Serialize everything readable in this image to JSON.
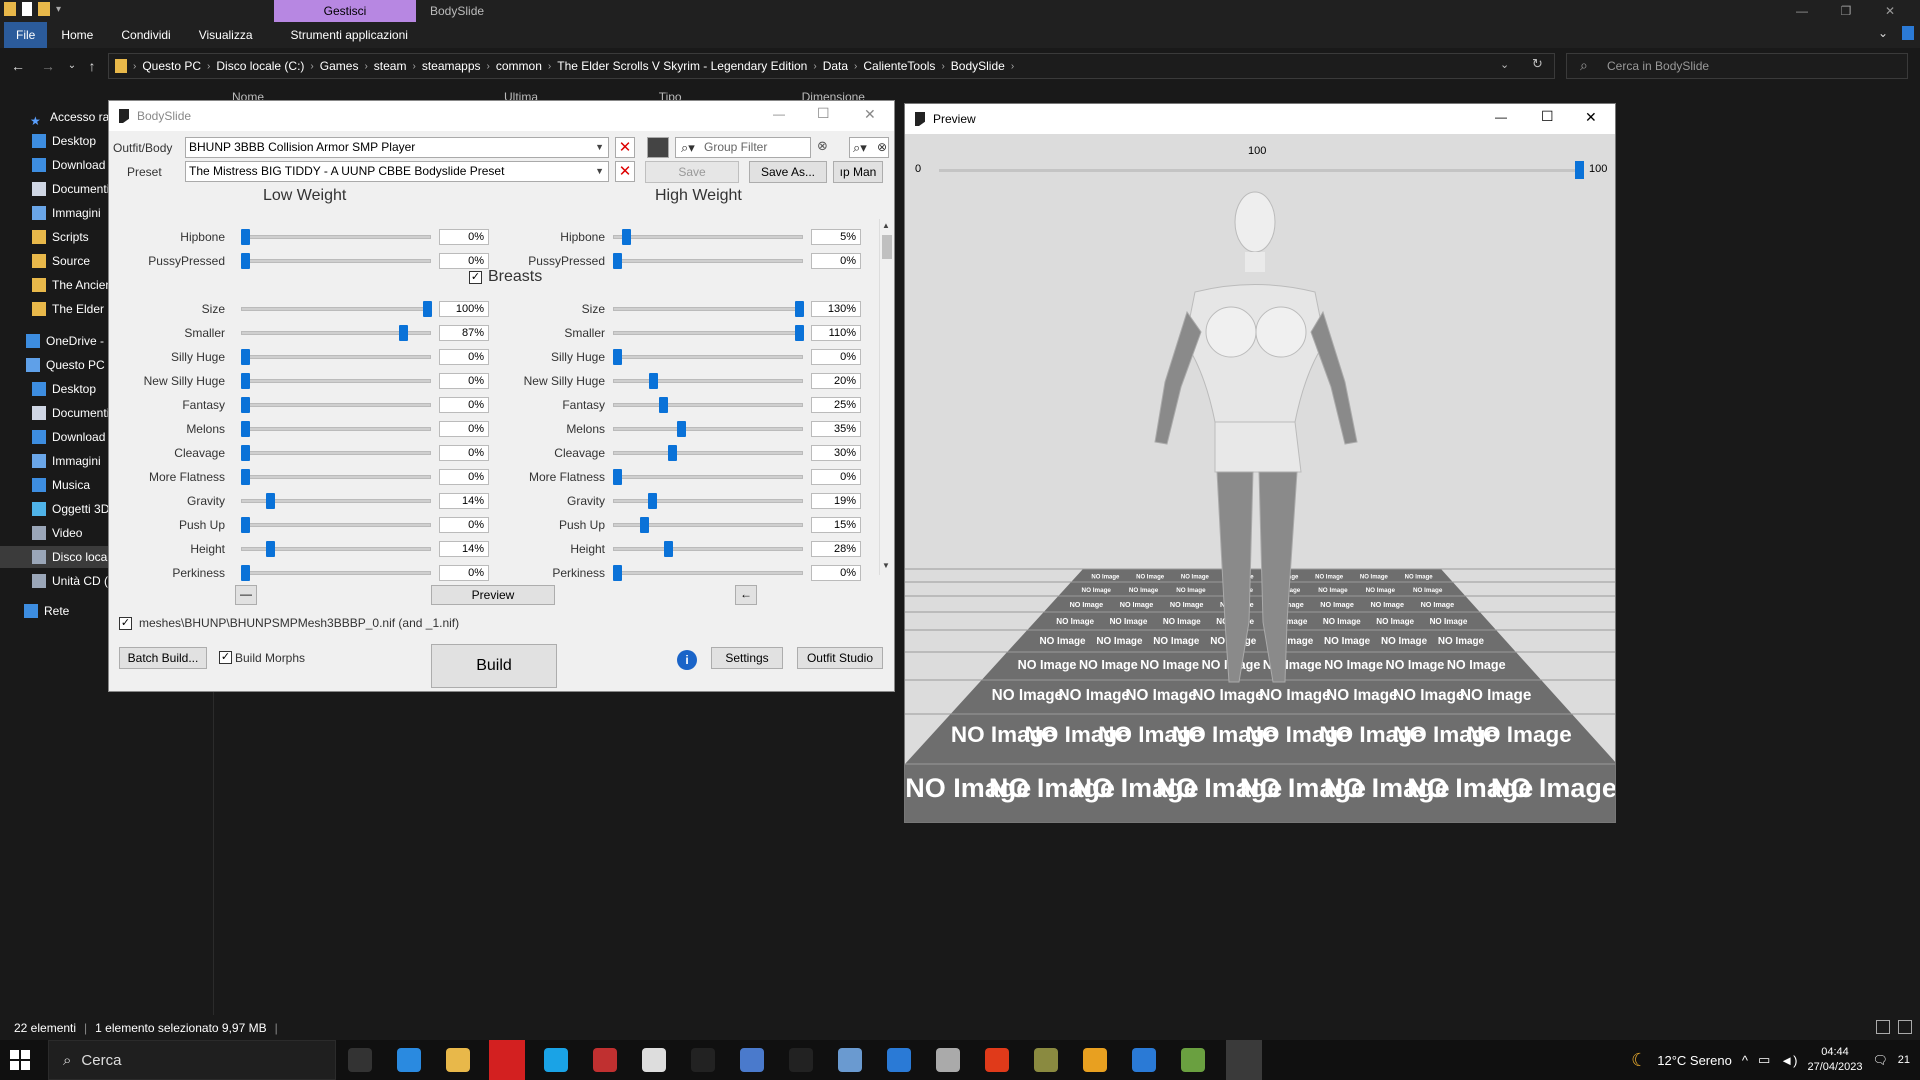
{
  "explorer": {
    "ribbon_tab_gestisci": "Gestisci",
    "window_title": "BodySlide",
    "ribbon_tabs": [
      "File",
      "Home",
      "Condividi",
      "Visualizza",
      "Strumenti applicazioni"
    ],
    "breadcrumbs": [
      "Questo PC",
      "Disco locale (C:)",
      "Games",
      "steam",
      "steamapps",
      "common",
      "The Elder Scrolls V Skyrim - Legendary Edition",
      "Data",
      "CalienteTools",
      "BodySlide"
    ],
    "search_placeholder": "Cerca in BodySlide",
    "column_headers": [
      "Nome",
      "Ultima modifica",
      "Tipo",
      "Dimensione"
    ],
    "nav_items": [
      {
        "label": "Accesso rapido",
        "icon": "star-icon"
      },
      {
        "label": "Desktop",
        "icon": "desktop-icon"
      },
      {
        "label": "Download",
        "icon": "download-icon"
      },
      {
        "label": "Documenti",
        "icon": "documents-icon"
      },
      {
        "label": "Immagini",
        "icon": "pictures-icon"
      },
      {
        "label": "Scripts",
        "icon": "folder-icon"
      },
      {
        "label": "Source",
        "icon": "folder-icon"
      },
      {
        "label": "The Ancient",
        "icon": "folder-icon"
      },
      {
        "label": "The Elder S",
        "icon": "folder-icon"
      },
      {
        "label": "OneDrive - P",
        "icon": "cloud-icon"
      },
      {
        "label": "Questo PC",
        "icon": "pc-icon"
      },
      {
        "label": "Desktop",
        "icon": "desktop-icon"
      },
      {
        "label": "Documenti",
        "icon": "documents-icon"
      },
      {
        "label": "Download",
        "icon": "download-icon"
      },
      {
        "label": "Immagini",
        "icon": "pictures-icon"
      },
      {
        "label": "Musica",
        "icon": "music-icon"
      },
      {
        "label": "Oggetti 3D",
        "icon": "3d-objects-icon"
      },
      {
        "label": "Video",
        "icon": "video-icon"
      },
      {
        "label": "Disco locale",
        "icon": "drive-icon"
      },
      {
        "label": "Unità CD (",
        "icon": "cd-drive-icon"
      },
      {
        "label": "Rete",
        "icon": "network-icon"
      }
    ],
    "status": {
      "count": "22 elementi",
      "selection": "1 elemento selezionato  9,97 MB"
    }
  },
  "bodyslide": {
    "title": "BodySlide",
    "outfit_label": "Outfit/Body",
    "outfit_value": "BHUNP 3BBB Collision Armor SMP Player",
    "group_filter_placeholder": "Group Filter",
    "preset_label": "Preset",
    "preset_value": "The Mistress BIG TIDDY - A UUNP CBBE Bodyslide Preset",
    "save_label": "Save",
    "save_as_label": "Save As...",
    "group_manager_label": "ıp Man",
    "low_weight": "Low Weight",
    "high_weight": "High Weight",
    "breasts_label": "Breasts",
    "preview_button": "Preview",
    "minus_low": "—",
    "minus_high": "←",
    "mesh_path": "meshes\\BHUNP\\BHUNPSMPMesh3BBBP_0.nif (and _1.nif)",
    "batch_build": "Batch Build...",
    "build_morphs": "Build Morphs",
    "build": "Build",
    "settings": "Settings",
    "outfit_studio": "Outfit Studio",
    "sliders": [
      {
        "name": "Hipbone",
        "low": 0,
        "low_label": "0%",
        "high": 5,
        "high_label": "5%",
        "max": 100
      },
      {
        "name": "PussyPressed",
        "low": 0,
        "low_label": "0%",
        "high": 0,
        "high_label": "0%",
        "max": 100
      },
      {
        "name": "Size",
        "low": 100,
        "low_label": "100%",
        "high": 130,
        "high_label": "130%",
        "max": 100
      },
      {
        "name": "Smaller",
        "low": 87,
        "low_label": "87%",
        "high": 110,
        "high_label": "110%",
        "max": 100
      },
      {
        "name": "Silly Huge",
        "low": 0,
        "low_label": "0%",
        "high": 0,
        "high_label": "0%",
        "max": 100
      },
      {
        "name": "New Silly Huge",
        "low": 0,
        "low_label": "0%",
        "high": 20,
        "high_label": "20%",
        "max": 100
      },
      {
        "name": "Fantasy",
        "low": 0,
        "low_label": "0%",
        "high": 25,
        "high_label": "25%",
        "max": 100
      },
      {
        "name": "Melons",
        "low": 0,
        "low_label": "0%",
        "high": 35,
        "high_label": "35%",
        "max": 100
      },
      {
        "name": "Cleavage",
        "low": 0,
        "low_label": "0%",
        "high": 30,
        "high_label": "30%",
        "max": 100
      },
      {
        "name": "More Flatness",
        "low": 0,
        "low_label": "0%",
        "high": 0,
        "high_label": "0%",
        "max": 100
      },
      {
        "name": "Gravity",
        "low": 14,
        "low_label": "14%",
        "high": 19,
        "high_label": "19%",
        "max": 100
      },
      {
        "name": "Push Up",
        "low": 0,
        "low_label": "0%",
        "high": 15,
        "high_label": "15%",
        "max": 100
      },
      {
        "name": "Height",
        "low": 14,
        "low_label": "14%",
        "high": 28,
        "high_label": "28%",
        "max": 100
      },
      {
        "name": "Perkiness",
        "low": 0,
        "low_label": "0%",
        "high": 0,
        "high_label": "0%",
        "max": 100
      }
    ]
  },
  "preview": {
    "title": "Preview",
    "weight_value": "100",
    "slider_min": "0",
    "slider_max": "100",
    "weight_fraction": 1.0,
    "floor_text": "NO Image"
  },
  "taskbar": {
    "search_placeholder": "Cerca",
    "weather": "12°C  Sereno",
    "time": "04:44",
    "date": "27/04/2023",
    "notifications": "21"
  }
}
